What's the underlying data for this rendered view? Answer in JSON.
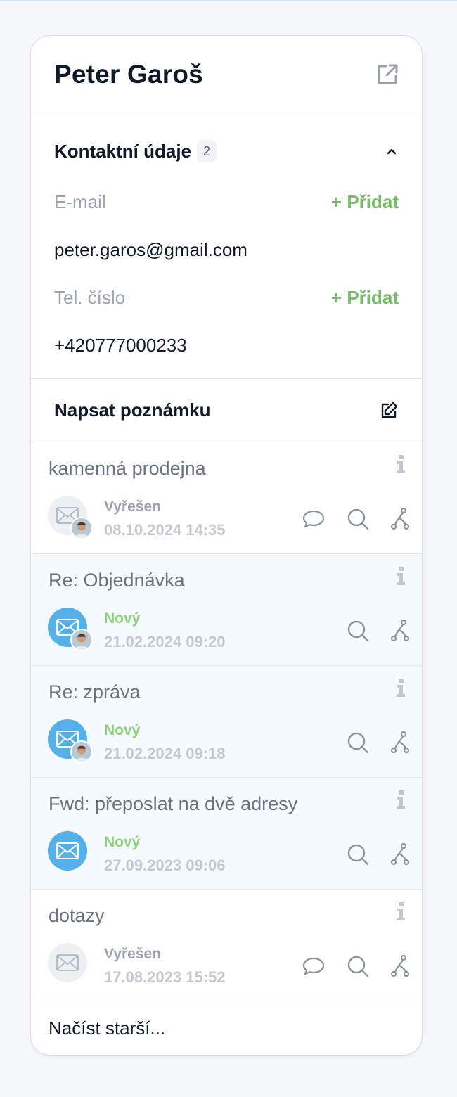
{
  "contact": {
    "name": "Peter Garoš",
    "section_title": "Kontaktní údaje",
    "count": "2",
    "email_label": "E-mail",
    "email_add": "+ Přidat",
    "email_value": "peter.garos@gmail.com",
    "phone_label": "Tel. číslo",
    "phone_add": "+ Přidat",
    "phone_value": "+420777000233"
  },
  "note": {
    "label": "Napsat poznámku"
  },
  "conversations": [
    {
      "title": "kamenná prodejna",
      "status": "Vyřešen",
      "date": "08.10.2024 14:35"
    },
    {
      "title": "Re: Objednávka",
      "status": "Nový",
      "date": "21.02.2024 09:20"
    },
    {
      "title": "Re: zpráva",
      "status": "Nový",
      "date": "21.02.2024 09:18"
    },
    {
      "title": "Fwd: přeposlat na dvě adresy",
      "status": "Nový",
      "date": "27.09.2023 09:06"
    },
    {
      "title": "dotazy",
      "status": "Vyřešen",
      "date": "17.08.2023 15:52"
    }
  ],
  "load_more": "Načíst starší...",
  "colors": {
    "accent_green": "#78b96a",
    "new_status": "#8ed07c",
    "envelope_blue": "#55b0e8",
    "new_row_bg": "#f5fafe"
  }
}
